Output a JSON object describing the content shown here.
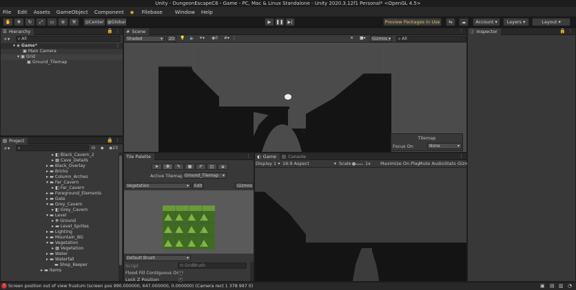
{
  "window": {
    "title": "Unity - DungeonEscapeC6 - Game - PC, Mac & Linux Standalone - Unity 2020.3.12f1 Personal* <OpenGL 4.5>"
  },
  "menu": [
    "File",
    "Edit",
    "Assets",
    "GameObject",
    "Component",
    "Filebase",
    "Window",
    "Help"
  ],
  "toolbar": {
    "center": "Center",
    "global": "Global",
    "preview": "Preview Packages In Use",
    "account": "Account",
    "layers": "Layers",
    "layout": "Layout"
  },
  "hierarchy": {
    "tab": "Hierarchy",
    "search": "All",
    "items": [
      "Game*",
      "Main Camera",
      "Grid",
      "Ground_Tilemap"
    ]
  },
  "project": {
    "tab": "Project",
    "count": "23",
    "items": [
      "Black_Cavern_2",
      "Cave_Details",
      "Black_Overlay",
      "Bricks",
      "Column_Arches",
      "Far_Cavern",
      "Far_Cavern",
      "Foreground_Elements",
      "Gate",
      "Grey_Cavern",
      "Grey_Cavern",
      "Level",
      "Ground",
      "Level_Sprites",
      "Lighting",
      "Mountain_BG",
      "Vegetation",
      "Vegetation",
      "Water",
      "Waterfall",
      "Shop_Keeper",
      "Items"
    ]
  },
  "scene": {
    "tab": "Scene",
    "shading": "Shaded",
    "mode2d": "2D",
    "fx_count": "0",
    "gizmos": "Gizmos",
    "search": "All",
    "tilemap_title": "Tilemap",
    "focus_label": "Focus On",
    "focus_value": "None"
  },
  "palette": {
    "tab": "Tile Palette",
    "active_label": "Active Tilemap",
    "active_value": "Ground_Tilemap",
    "palette_value": "Vegetation",
    "edit": "Edit",
    "gizmos": "Gizmos",
    "brush": "Default Brush",
    "script_label": "Script",
    "script_value": "GridBrush",
    "flood": "Flood Fill Contiguous Only",
    "lockz": "Lock Z Position"
  },
  "game": {
    "tab": "Game",
    "console_tab": "Console",
    "display": "Display 1",
    "aspect": "16:9 Aspect",
    "scale_label": "Scale",
    "scale_value": "1x",
    "maximize": "Maximize On Play",
    "mute": "Mute Audio",
    "stats": "Stats",
    "gizmos": "Gizmo"
  },
  "inspector": {
    "tab": "Inspector"
  },
  "status": {
    "message": "Screen position out of view frustum (screen pos 990.000000, 647.000000, 0.000000) (Camera rect 1 378 997 0)"
  },
  "colors": {
    "accent": "#3a72b0",
    "preview_bg": "#3a3a3a",
    "preview_text": "#e0c060",
    "error": "#d03030"
  }
}
